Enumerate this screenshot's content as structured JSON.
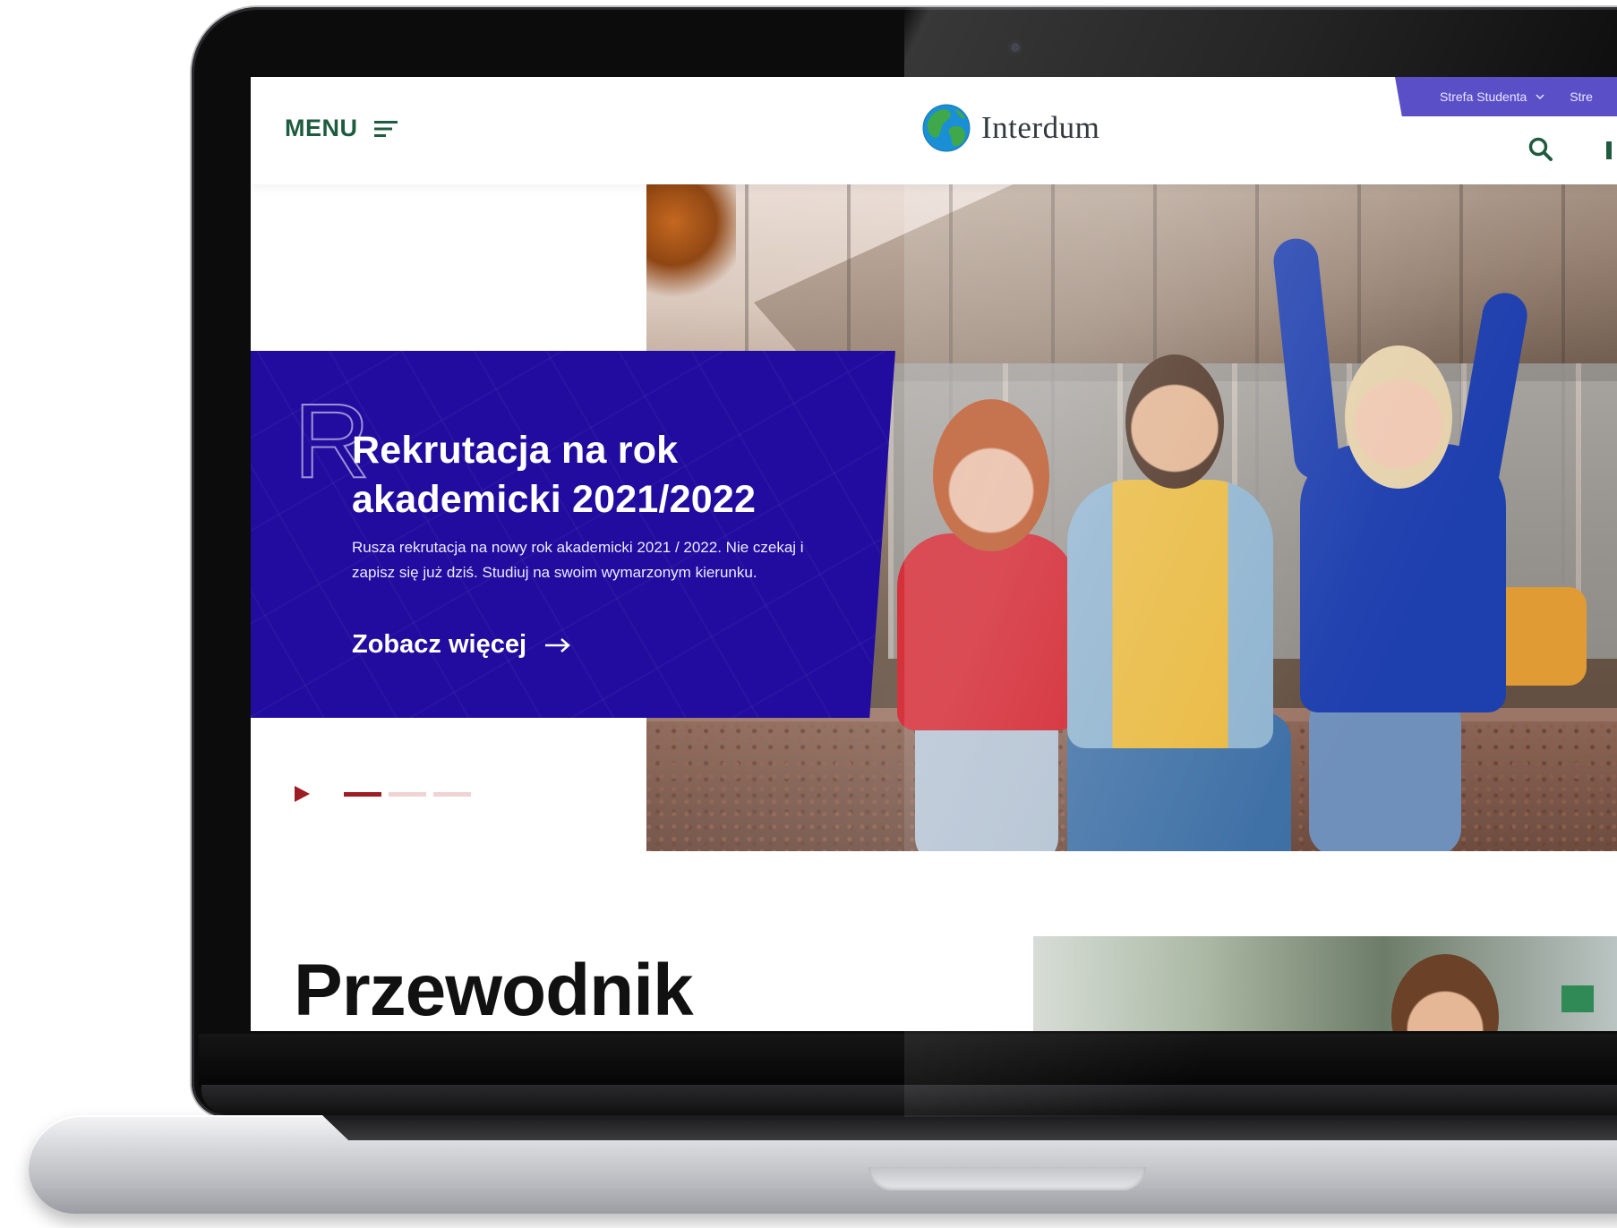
{
  "header": {
    "menu_label": "MENU",
    "logo_text": "Interdum",
    "top_tabs": [
      {
        "label": "Strefa Studenta"
      },
      {
        "label": "Stre"
      }
    ]
  },
  "hero": {
    "deco_letter": "R",
    "title": "Rekrutacja na rok akademicki 2021/2022",
    "description": "Rusza rekrutacja na nowy rok akademicki 2021 / 2022. Nie czekaj i zapisz się już dziś. Studiuj na swoim wymarzonym kierunku.",
    "cta_label": "Zobacz więcej",
    "slides_total": 3,
    "active_slide": 1
  },
  "section": {
    "title": "Przewodnik"
  },
  "colors": {
    "brand_green": "#1f5b3f",
    "hero_card_blue": "#210c9f",
    "top_bar_purple": "#5b4fc8",
    "slider_active": "#9e1c23",
    "slider_inactive": "#f0d3d3"
  }
}
